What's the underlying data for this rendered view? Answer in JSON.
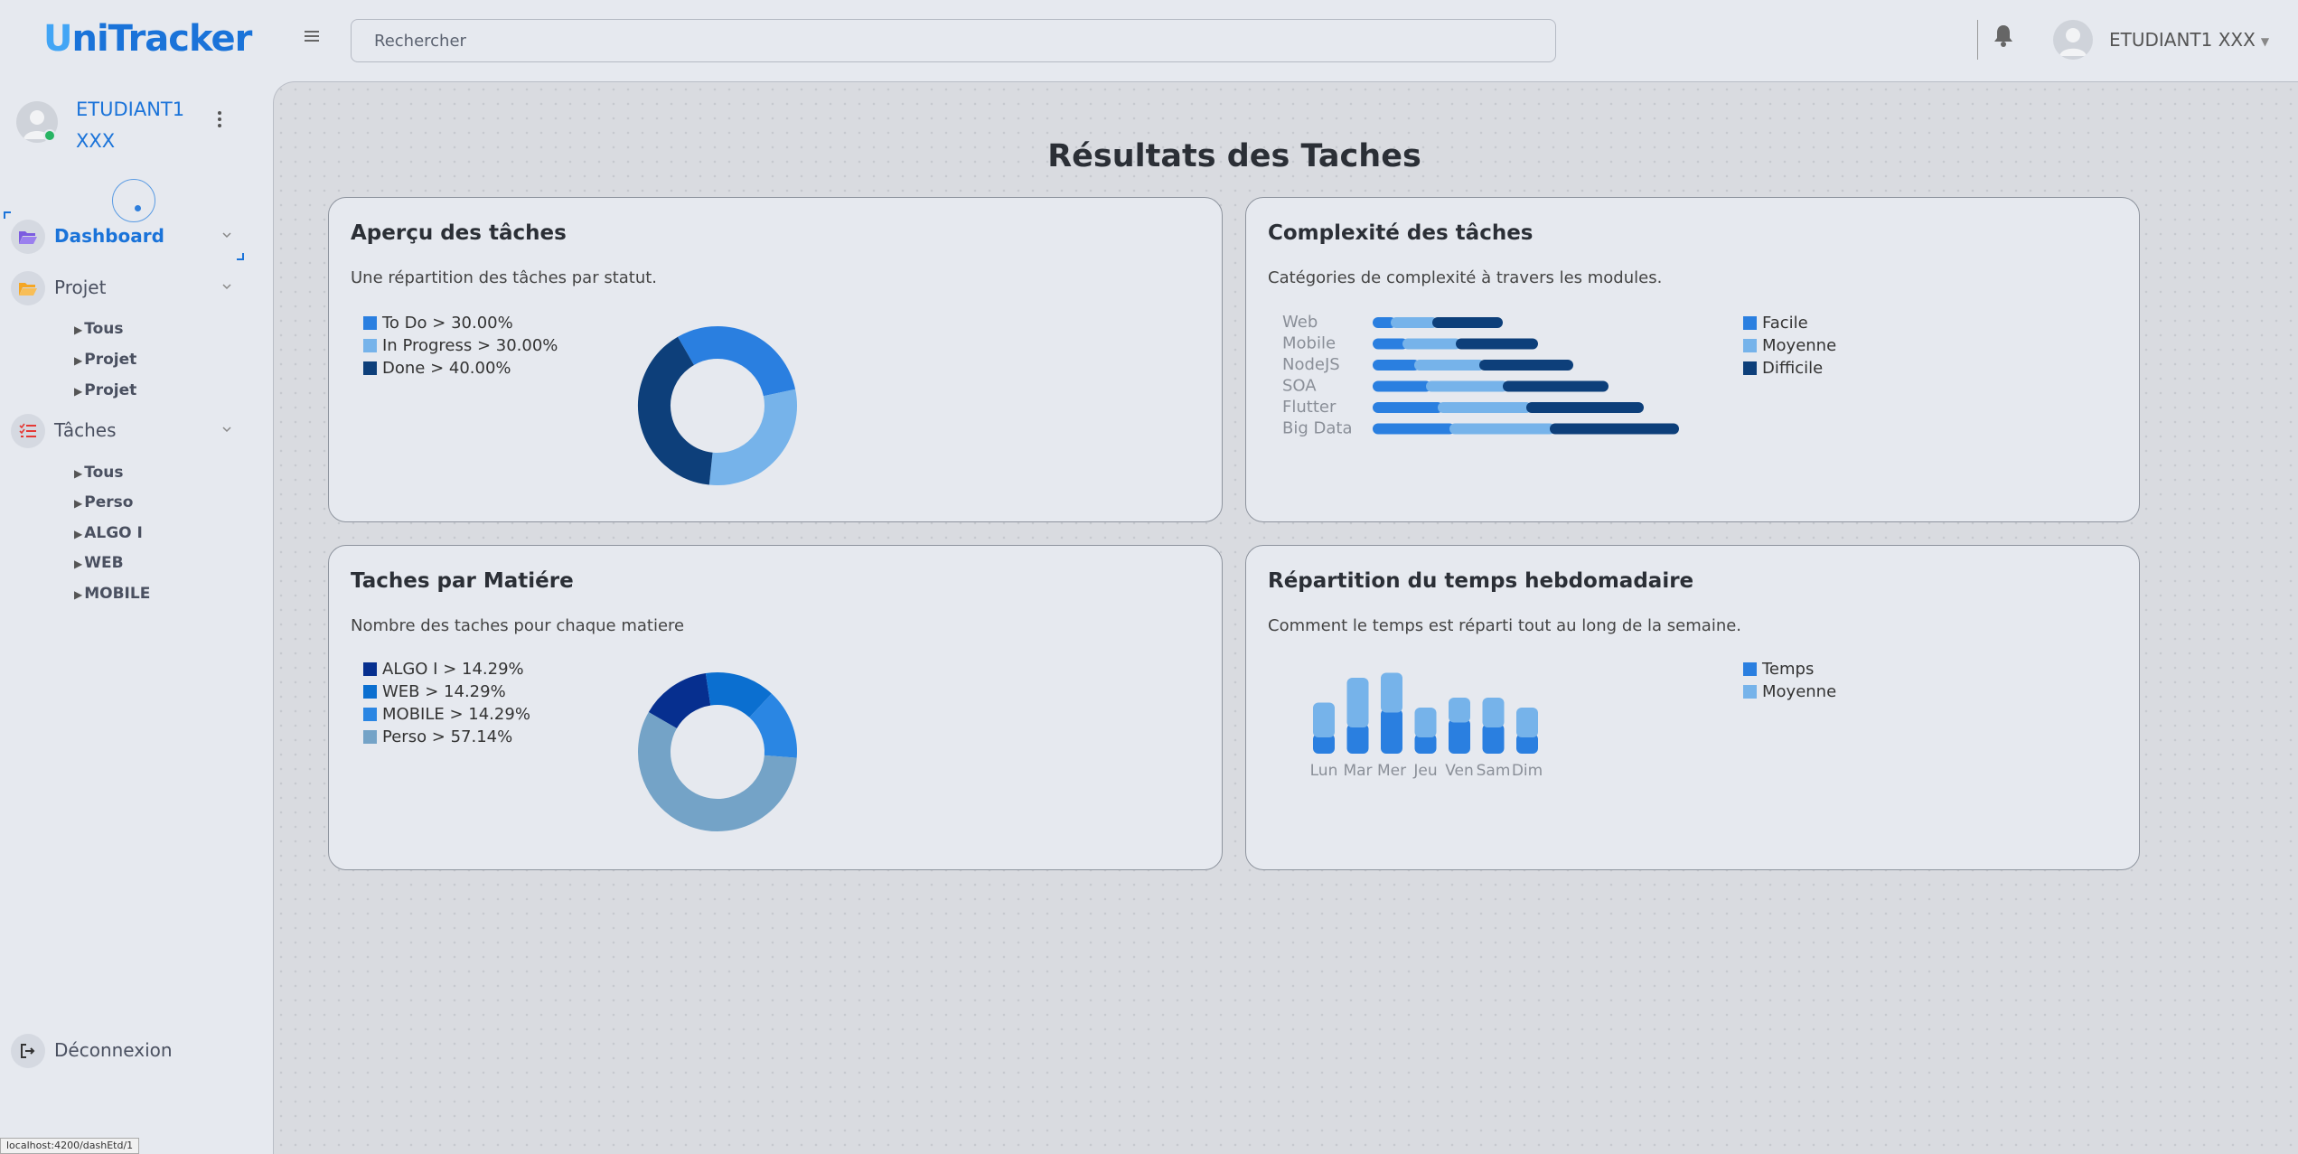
{
  "app": {
    "logo_first": "U",
    "logo_rest": "niTracker",
    "status_url": "localhost:4200/dashEtd/1"
  },
  "header": {
    "search_placeholder": "Rechercher",
    "user_name": "ETUDIANT1 XXX"
  },
  "sidebar": {
    "user_line1": "ETUDIANT1",
    "user_line2": "XXX",
    "nav": [
      {
        "label": "Dashboard",
        "icon": "folder-open-icon",
        "color": "#7c5ce0",
        "active": true
      },
      {
        "label": "Projet",
        "icon": "folder-open-icon",
        "color": "#f5a623",
        "active": false
      },
      {
        "label": "Tâches",
        "icon": "task-list-icon",
        "color": "#e53935",
        "active": false
      }
    ],
    "projet_items": [
      "Tous",
      "Projet",
      "Projet"
    ],
    "taches_items": [
      "Tous",
      "Perso",
      "ALGO I",
      "WEB",
      "MOBILE"
    ],
    "logout_label": "Déconnexion"
  },
  "main": {
    "title": "Résultats des Taches"
  },
  "cards": {
    "apercu": {
      "title": "Aperçu des tâches",
      "subtitle": "Une répartition des tâches par statut."
    },
    "complexite": {
      "title": "Complexité des tâches",
      "subtitle": "Catégories de complexité à travers les modules."
    },
    "matiere": {
      "title": "Taches par Matiére",
      "subtitle": "Nombre des taches pour chaque matiere"
    },
    "temps": {
      "title": "Répartition du temps hebdomadaire",
      "subtitle": "Comment le temps est réparti tout au long de la semaine."
    }
  },
  "chart_data": [
    {
      "id": "apercu",
      "type": "pie",
      "donut": true,
      "labels": [
        "To Do",
        "In Progress",
        "Done"
      ],
      "legend": [
        "To Do > 30.00%",
        "In Progress > 30.00%",
        "Done > 40.00%"
      ],
      "values": [
        30,
        30,
        40
      ],
      "colors": [
        "#2a7fe0",
        "#76b3ea",
        "#0d3f7a"
      ]
    },
    {
      "id": "complexite",
      "type": "bar",
      "orientation": "horizontal",
      "stacked": true,
      "categories": [
        "Web",
        "Mobile",
        "NodeJS",
        "SOA",
        "Flutter",
        "Big Data"
      ],
      "series": [
        {
          "name": "Facile",
          "values": [
            1,
            1.5,
            2,
            2.5,
            3,
            3.5
          ],
          "color": "#2a7fe0"
        },
        {
          "name": "Moyenne",
          "values": [
            2,
            2.5,
            3,
            3.5,
            4,
            4.5
          ],
          "color": "#76b3ea"
        },
        {
          "name": "Difficile",
          "values": [
            3,
            3.5,
            4,
            4.5,
            5,
            5.5
          ],
          "color": "#0d3f7a"
        }
      ]
    },
    {
      "id": "matiere",
      "type": "pie",
      "donut": true,
      "labels": [
        "ALGO I",
        "WEB",
        "MOBILE",
        "Perso"
      ],
      "legend": [
        "ALGO I > 14.29%",
        "WEB > 14.29%",
        "MOBILE > 14.29%",
        "Perso > 57.14%"
      ],
      "values": [
        14.29,
        14.29,
        14.29,
        57.14
      ],
      "colors": [
        "#062f8f",
        "#0b6fd0",
        "#2a86e3",
        "#74a3c7"
      ]
    },
    {
      "id": "temps",
      "type": "bar",
      "stacked": true,
      "categories": [
        "Lun",
        "Mar",
        "Mer",
        "Jeu",
        "Ven",
        "Sam",
        "Dim"
      ],
      "series": [
        {
          "name": "Temps",
          "values": [
            2,
            3,
            4.5,
            2,
            3.5,
            3,
            2
          ],
          "color": "#2a7fe0"
        },
        {
          "name": "Moyenne",
          "values": [
            3.5,
            5,
            4,
            3,
            2.5,
            3,
            3
          ],
          "color": "#76b3ea"
        }
      ]
    }
  ]
}
